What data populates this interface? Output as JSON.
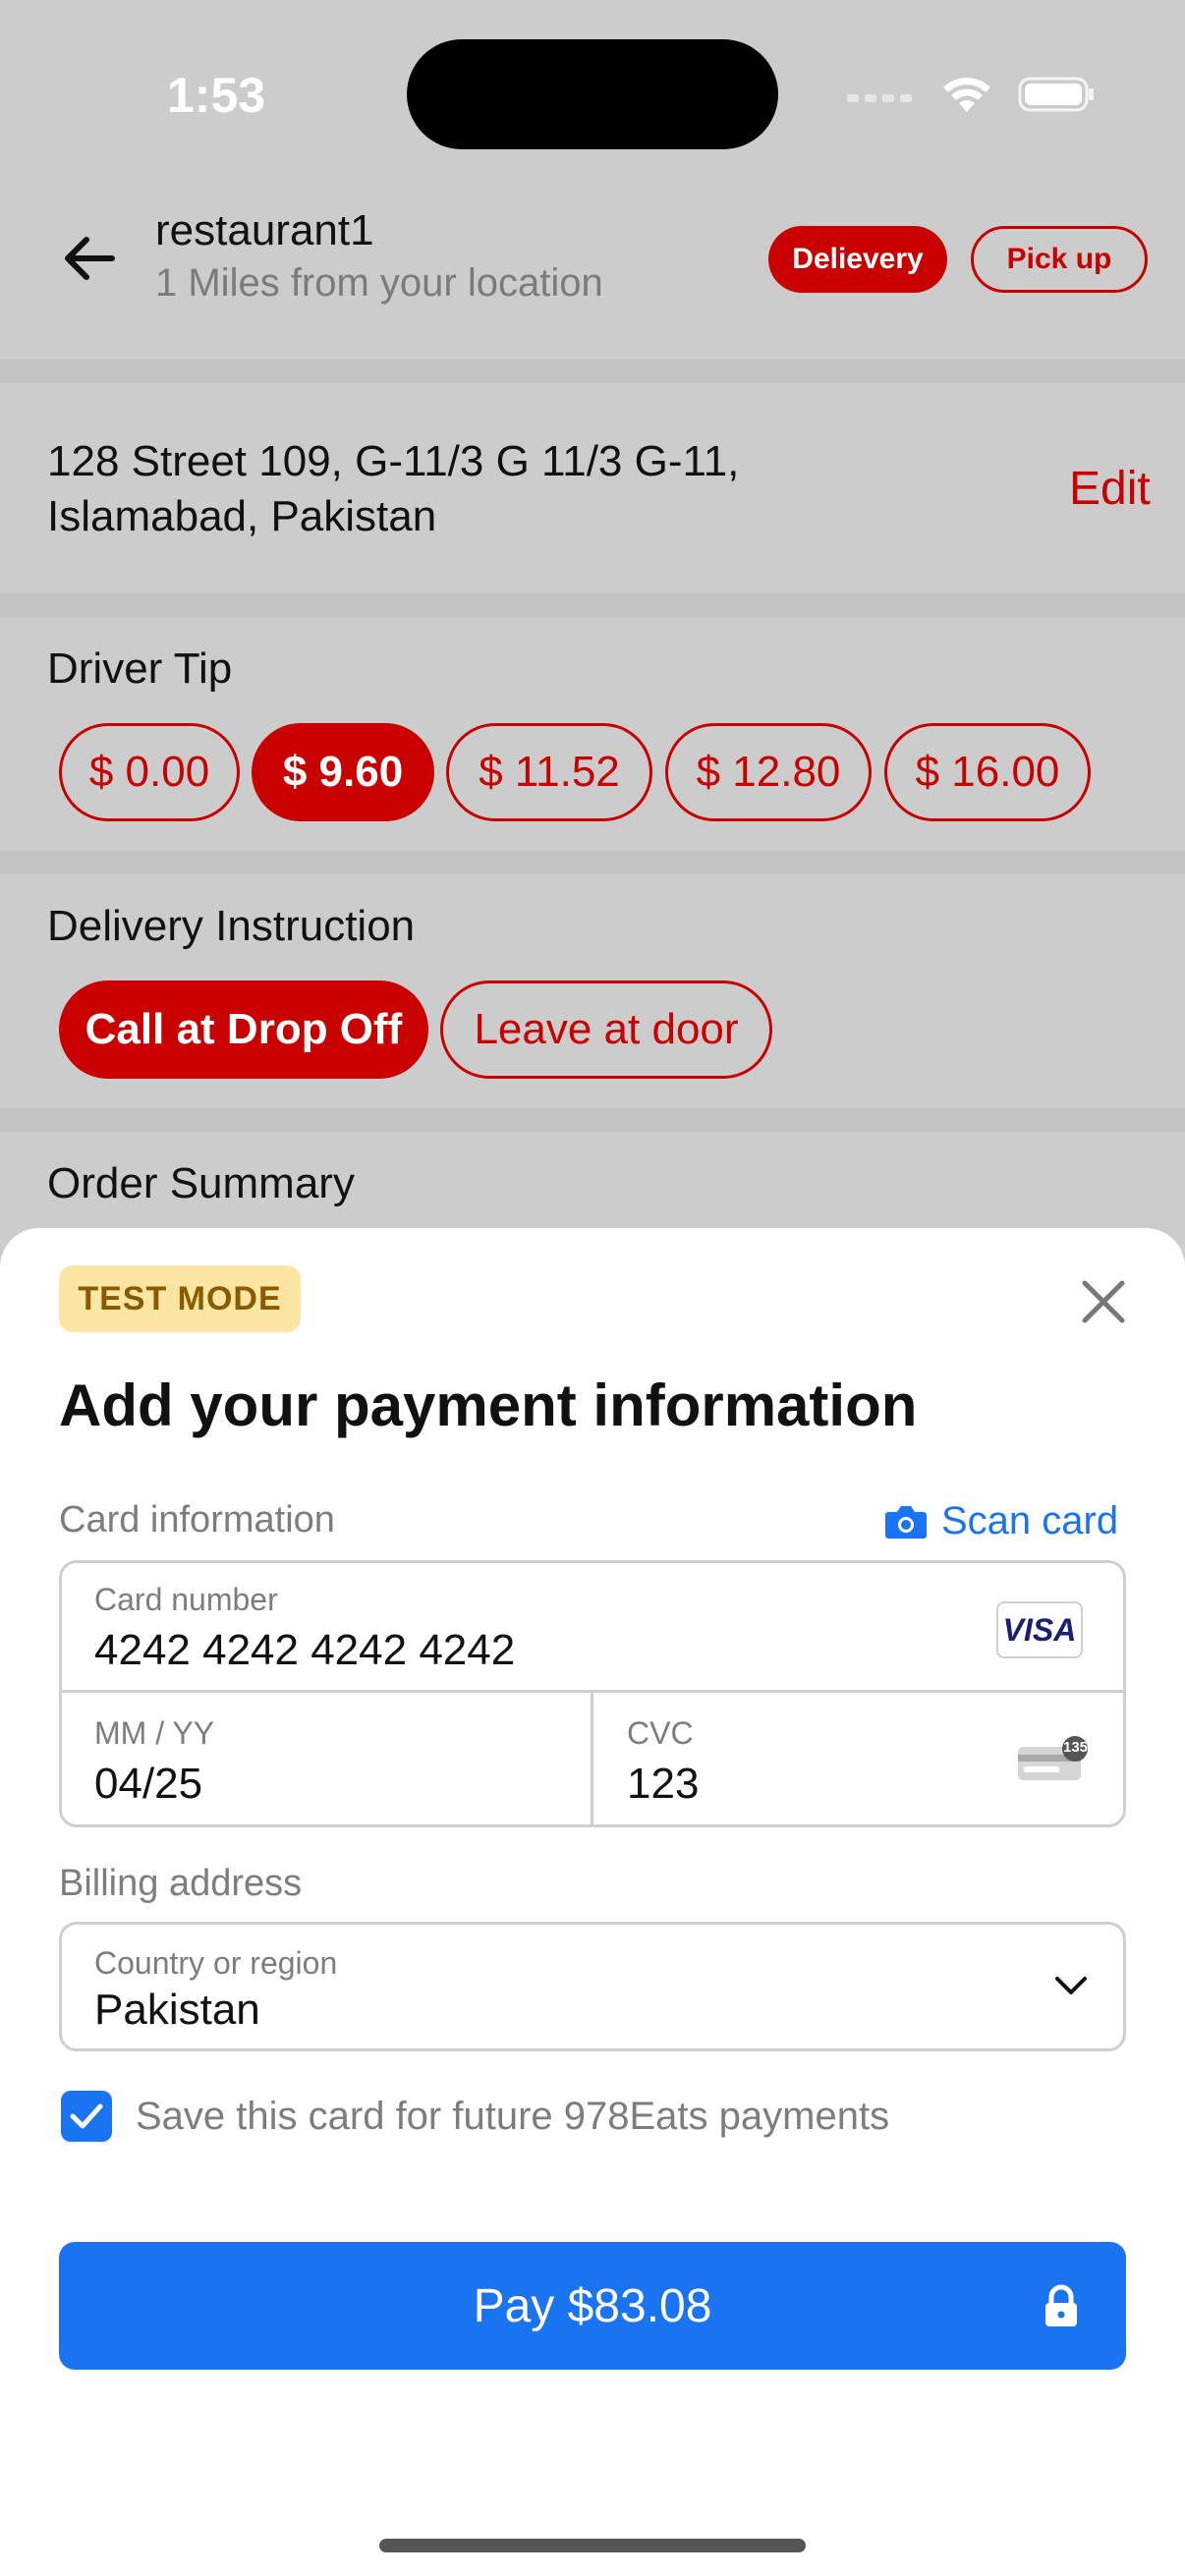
{
  "status_bar": {
    "time": "1:53",
    "icons": [
      "signal-icon",
      "wifi-icon",
      "battery-icon"
    ]
  },
  "header": {
    "restaurant_name": "restaurant1",
    "distance": "1 Miles from your location",
    "delivery_label": "Delievery",
    "pickup_label": "Pick up"
  },
  "address": {
    "line1": "128 Street 109, G-11/3 G 11/3 G-11,",
    "line2": "Islamabad, Pakistan",
    "edit_label": "Edit"
  },
  "driver_tip": {
    "title": "Driver Tip",
    "options": [
      "$ 0.00",
      "$ 9.60",
      "$ 11.52",
      "$ 12.80",
      "$ 16.00"
    ],
    "selected": "$ 9.60"
  },
  "delivery_instruction": {
    "title": "Delivery Instruction",
    "options": [
      "Call at Drop Off",
      "Leave at door"
    ],
    "selected": "Call at Drop Off"
  },
  "order_summary": {
    "title": "Order Summary"
  },
  "payment_sheet": {
    "test_badge": "TEST MODE",
    "title": "Add your payment information",
    "card_info_label": "Card information",
    "scan_card_label": "Scan card",
    "card_number_label": "Card number",
    "card_number_value": "4242 4242 4242 4242",
    "card_brand": "VISA",
    "expiry_label": "MM / YY",
    "expiry_value": "04/25",
    "cvc_label": "CVC",
    "cvc_value": "123",
    "cvc_icon_text": "135",
    "billing_label": "Billing address",
    "country_label": "Country or region",
    "country_value": "Pakistan",
    "save_card_label": "Save this card for future 978Eats payments",
    "save_card_checked": true,
    "pay_label": "Pay $83.08"
  },
  "colors": {
    "brand_red": "#c90000",
    "stripe_blue": "#1a73f0",
    "test_badge_bg": "#fde6a3"
  }
}
